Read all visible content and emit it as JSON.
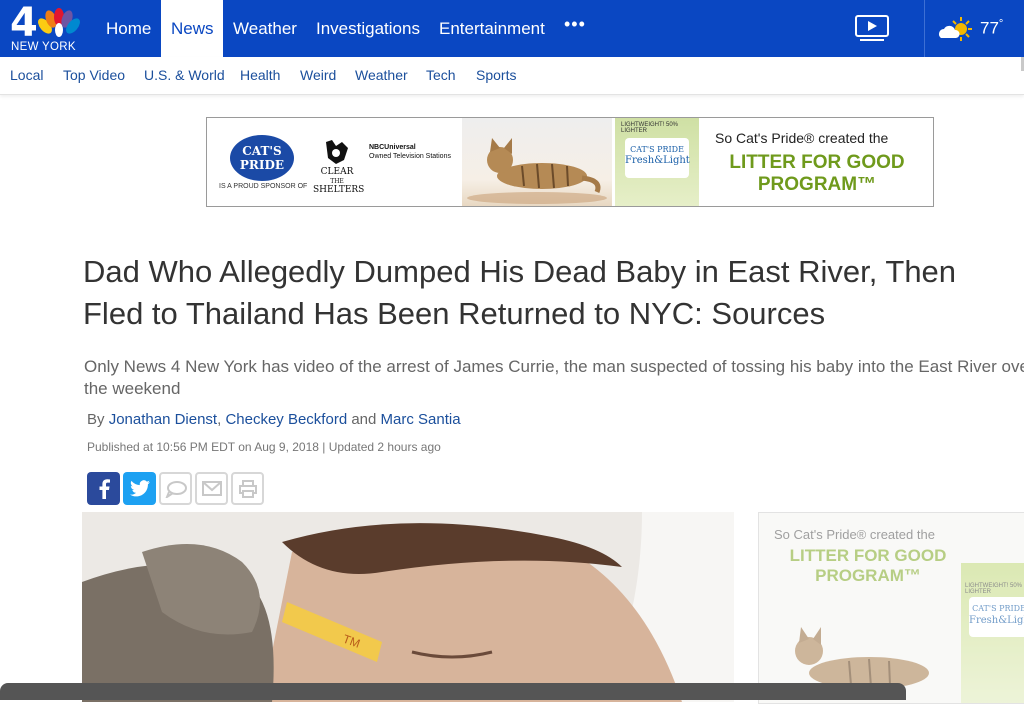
{
  "header": {
    "logo_number": "4",
    "logo_text": "NEW YORK",
    "nav": [
      {
        "label": "Home"
      },
      {
        "label": "News",
        "active": true
      },
      {
        "label": "Weather"
      },
      {
        "label": "Investigations"
      },
      {
        "label": "Entertainment"
      }
    ],
    "more": "•••",
    "temperature": "77",
    "degree": "°",
    "colors": {
      "nav_bg": "#0a47c2",
      "link": "#1b4f9c"
    }
  },
  "subnav": [
    "Local",
    "Top Video",
    "U.S. & World",
    "Health",
    "Weird",
    "Weather",
    "Tech",
    "Sports"
  ],
  "ad_banner": {
    "logo_line1": "CAT'S",
    "logo_line2": "PRIDE",
    "sponsor": "IS A PROUD SPONSOR OF",
    "clear_line1": "CLEAR",
    "clear_line2": "THE",
    "clear_line3": "SHELTERS",
    "nbc_line1": "NBCUniversal",
    "nbc_line2": "Owned Television Stations",
    "bag_strip": "LIGHTWEIGHT! 50% LIGHTER",
    "bag_line1": "CAT'S PRIDE",
    "bag_line2": "Fresh&Light",
    "tagline": "So Cat's Pride® created the",
    "headline_line1": "LITTER FOR GOOD",
    "headline_line2": "PROGRAM™"
  },
  "article": {
    "headline_line1": "Dad Who Allegedly Dumped His Dead Baby in East River, Then",
    "headline_line2": "Fled to Thailand Has Been Returned to NYC: Sources",
    "summary": "Only News 4 New York has video of the arrest of James Currie, the man suspected of tossing his baby into the East River over the weekend",
    "by": "By",
    "authors": [
      "Jonathan Dienst",
      "Checkey Beckford",
      "Marc Santia"
    ],
    "sep1": ",",
    "sep2": "and",
    "published": "Published at 10:56 PM EDT on Aug 9, 2018 | Updated 2 hours ago"
  },
  "share_buttons": [
    "facebook-icon",
    "twitter-icon",
    "comment-icon",
    "email-icon",
    "print-icon"
  ],
  "side_ad": {
    "tagline": "So Cat's Pride® created the",
    "headline_line1": "LITTER FOR GOOD",
    "headline_line2": "PROGRAM™",
    "bag_strip": "LIGHTWEIGHT! 50% LIGHTER",
    "bag_line1": "CAT'S PRIDE",
    "bag_line2": "Fresh&Light"
  }
}
